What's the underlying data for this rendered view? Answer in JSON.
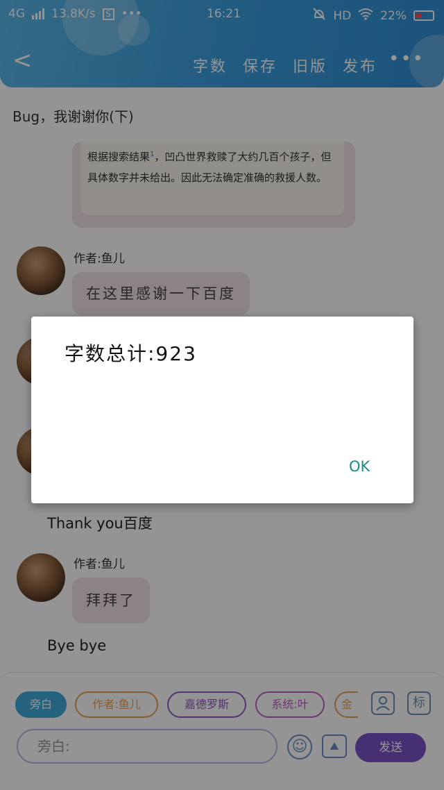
{
  "status_bar": {
    "network": "4G",
    "speed": "13.8K/s",
    "s_icon": "S",
    "dots": "•••",
    "time": "16:21",
    "hd": "HD",
    "battery": "22%"
  },
  "nav": {
    "back": "<",
    "items": [
      "字数",
      "保存",
      "旧版",
      "发布"
    ],
    "more": "•••"
  },
  "doc_title": "Bug，我谢谢你(下)",
  "card": {
    "text": "根据搜索结果",
    "sup": "1",
    "text_rest": "，凹凸世界救赎了大约几百个孩子，但具体数字并未给出。因此无法确定准确的救援人数。"
  },
  "messages": [
    {
      "author": "作者:鱼儿",
      "text": "在这里感谢一下百度"
    },
    {
      "narration": "Thank you百度"
    },
    {
      "author": "作者:鱼儿",
      "text": "拜拜了"
    },
    {
      "narration": "Bye bye"
    }
  ],
  "chips": [
    "旁白",
    "作者:鱼儿",
    "嘉德罗斯",
    "系统:叶",
    "金"
  ],
  "icons": {
    "person": "person-icon",
    "mark": "标",
    "emoji": "☺",
    "image": "⛰"
  },
  "input": {
    "placeholder": "旁白:"
  },
  "send_label": "发送",
  "dialog": {
    "text": "字数总计:923",
    "ok": "OK"
  },
  "colors": {
    "header": "#3fa2df",
    "send": "#7a52c8",
    "ok": "#1e8a86",
    "chip_active": "#3fa9d8"
  }
}
